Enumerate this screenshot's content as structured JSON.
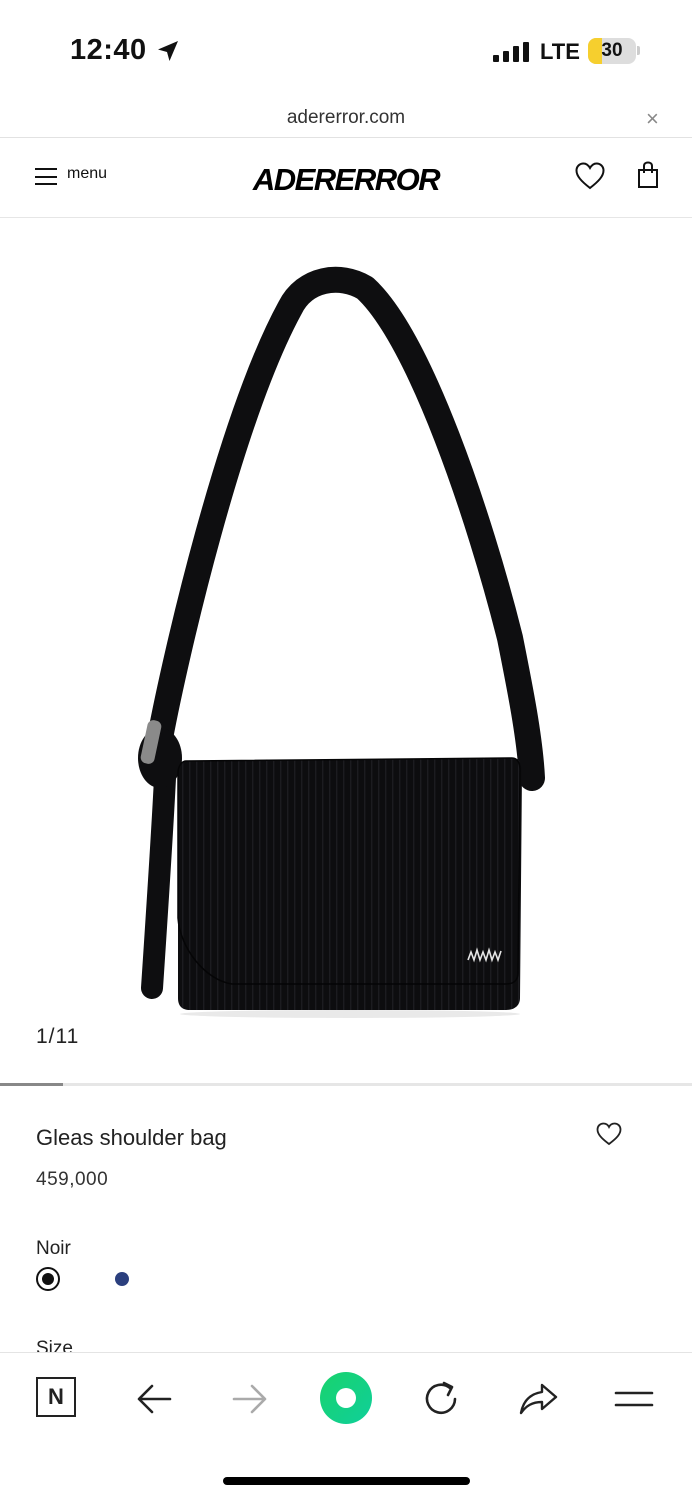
{
  "status_bar": {
    "time": "12:40",
    "network": "LTE",
    "battery": "30",
    "battery_level": 0.3,
    "icons": [
      "location-arrow-icon",
      "signal-icon",
      "battery-icon"
    ]
  },
  "browser": {
    "url": "adererror.com",
    "close_glyph": "×"
  },
  "header": {
    "menu_label": "menu",
    "brand": "ADERERROR",
    "icons": [
      "hamburger-icon",
      "heart-icon",
      "shopping-bag-icon"
    ]
  },
  "gallery": {
    "counter": "1/11",
    "current": 1,
    "total": 11
  },
  "product": {
    "name": "Gleas shoulder bag",
    "price": "459,000",
    "color_label": "Noir",
    "colors": [
      {
        "name": "Noir",
        "hex": "#111111",
        "selected": true
      },
      {
        "name": "Navy",
        "hex": "#2b3f7e",
        "selected": false
      }
    ],
    "size_label": "Size"
  },
  "toolbar": {
    "n_label": "N",
    "icons": [
      "naver-n-icon",
      "back-arrow-icon",
      "forward-arrow-icon",
      "home-green-icon",
      "reload-icon",
      "share-icon",
      "menu-lines-icon"
    ]
  },
  "colors": {
    "accent_green": "#19d36d",
    "battery_yellow": "#f6cf2e"
  }
}
